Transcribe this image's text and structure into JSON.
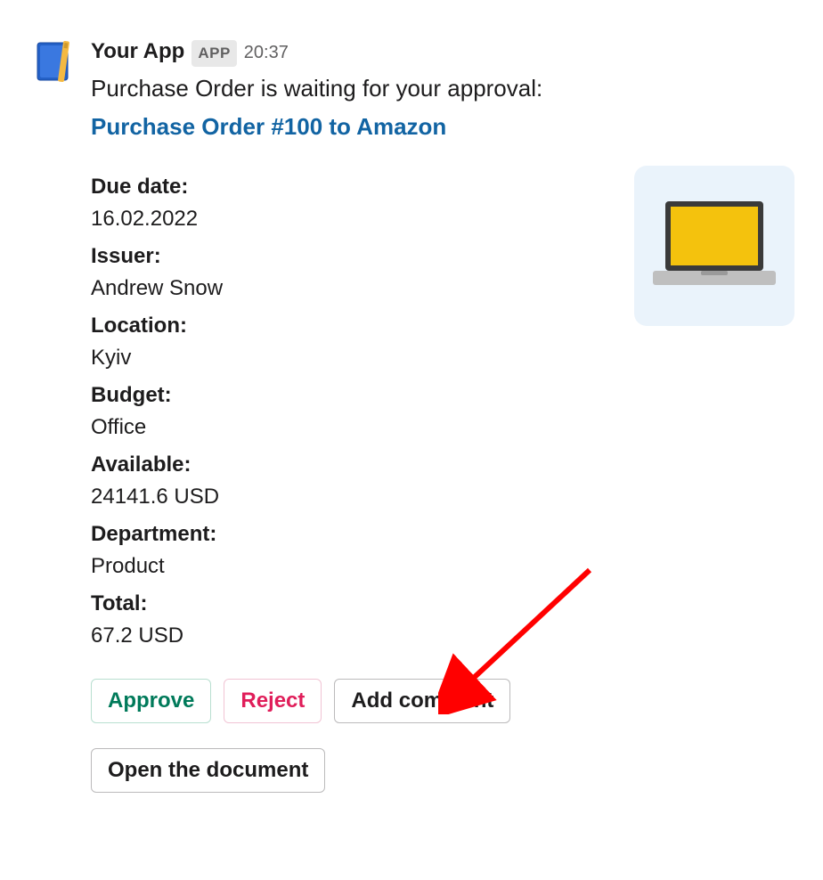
{
  "header": {
    "app_name": "Your App",
    "app_badge": "APP",
    "timestamp": "20:37"
  },
  "intro": "Purchase Order is waiting for your approval:",
  "link_text": "Purchase Order #100 to Amazon",
  "fields": {
    "due_date_label": "Due date:",
    "due_date_value": "16.02.2022",
    "issuer_label": "Issuer:",
    "issuer_value": "Andrew Snow",
    "location_label": "Location:",
    "location_value": "Kyiv",
    "budget_label": "Budget:",
    "budget_value": "Office",
    "available_label": "Available:",
    "available_value": "24141.6 USD",
    "department_label": "Department:",
    "department_value": "Product",
    "total_label": "Total:",
    "total_value": "67.2 USD"
  },
  "buttons": {
    "approve": "Approve",
    "reject": "Reject",
    "add_comment": "Add comment",
    "open_document": "Open the document"
  }
}
